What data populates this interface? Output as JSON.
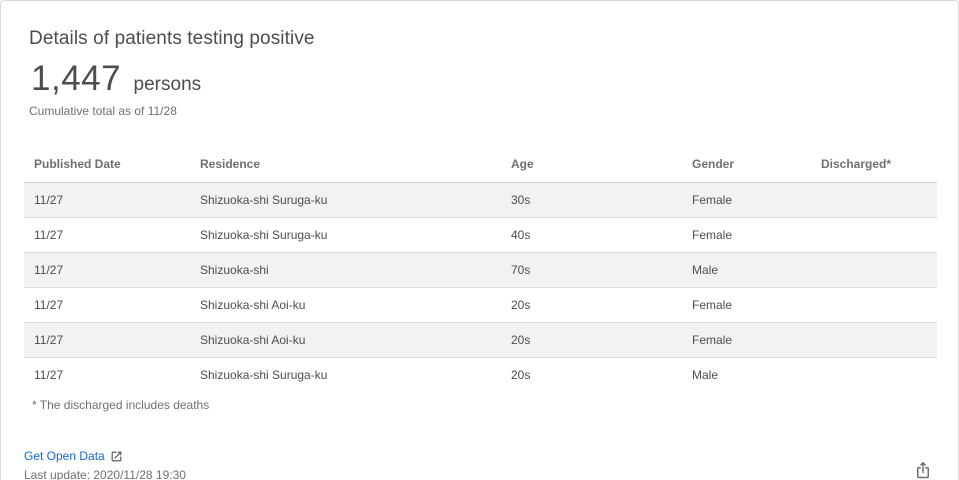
{
  "card": {
    "title": "Details of patients testing positive",
    "total": "1,447",
    "unit": "persons",
    "subtitle": "Cumulative total as of 11/28"
  },
  "table": {
    "headers": [
      "Published Date",
      "Residence",
      "Age",
      "Gender",
      "Discharged*"
    ],
    "rows": [
      [
        "11/27",
        "Shizuoka-shi Suruga-ku",
        "30s",
        "Female",
        ""
      ],
      [
        "11/27",
        "Shizuoka-shi Suruga-ku",
        "40s",
        "Female",
        ""
      ],
      [
        "11/27",
        "Shizuoka-shi",
        "70s",
        "Male",
        ""
      ],
      [
        "11/27",
        "Shizuoka-shi Aoi-ku",
        "20s",
        "Female",
        ""
      ],
      [
        "11/27",
        "Shizuoka-shi Aoi-ku",
        "20s",
        "Female",
        ""
      ],
      [
        "11/27",
        "Shizuoka-shi Suruga-ku",
        "20s",
        "Male",
        ""
      ]
    ]
  },
  "footer": {
    "note": "* The discharged includes deaths",
    "open_data_label": "Get Open Data",
    "open_data_icon": "external-link-icon",
    "last_update": "Last update: 2020/11/28 19:30",
    "share_icon": "share-icon"
  },
  "colors": {
    "link": "#1268d8",
    "text": "#4d4d4d",
    "muted": "#707070",
    "row_stripe": "#f2f2f2"
  }
}
